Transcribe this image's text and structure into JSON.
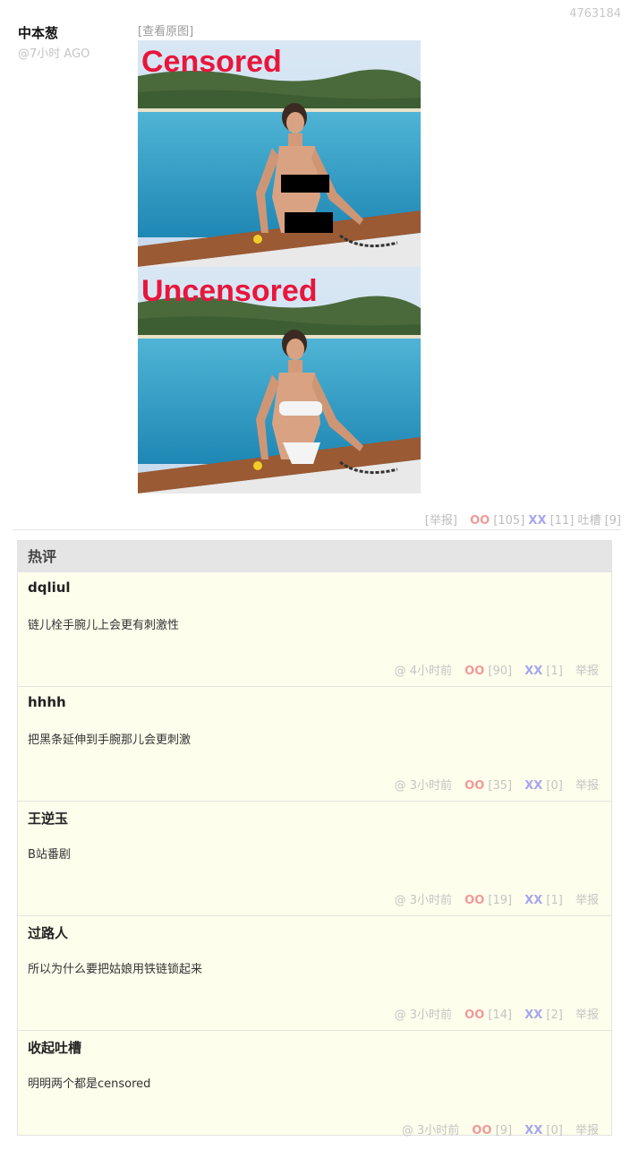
{
  "post": {
    "id": "4763184",
    "author": "中本葱",
    "time": "@7小时 AGO",
    "view_original": "[查看原图]",
    "images": [
      {
        "caption": "Censored"
      },
      {
        "caption": "Uncensored"
      }
    ],
    "report": "[举报]",
    "oo_label": "OO",
    "oo_count": "[105]",
    "xx_label": "XX",
    "xx_count": "[11]",
    "tucao": "吐槽 [9]"
  },
  "hot": {
    "title": "热评",
    "comments": [
      {
        "name": "dqliul",
        "text": "链儿栓手腕儿上会更有刺激性",
        "at": "@",
        "time": "4小时前",
        "oo": "OO",
        "oo_count": "[90]",
        "xx": "XX",
        "xx_count": "[1]",
        "report": "举报"
      },
      {
        "name": "hhhh",
        "text": "把黑条延伸到手腕那儿会更刺激",
        "at": "@",
        "time": "3小时前",
        "oo": "OO",
        "oo_count": "[35]",
        "xx": "XX",
        "xx_count": "[0]",
        "report": "举报"
      },
      {
        "name": "王逆玉",
        "text": "B站番剧",
        "at": "@",
        "time": "3小时前",
        "oo": "OO",
        "oo_count": "[19]",
        "xx": "XX",
        "xx_count": "[1]",
        "report": "举报"
      },
      {
        "name": "过路人",
        "text": "所以为什么要把姑娘用铁链锁起来",
        "at": "@",
        "time": "3小时前",
        "oo": "OO",
        "oo_count": "[14]",
        "xx": "XX",
        "xx_count": "[2]",
        "report": "举报"
      },
      {
        "name": "收起吐槽",
        "text": "明明两个都是censored",
        "at": "@",
        "time": "3小时前",
        "oo": "OO",
        "oo_count": "[9]",
        "xx": "XX",
        "xx_count": "[0]",
        "report": "举报"
      }
    ]
  },
  "colors": {
    "oo": "#f19999",
    "xx": "#a6a6ee",
    "caption": "#e8163c",
    "panel_bg": "#fdfeec"
  }
}
